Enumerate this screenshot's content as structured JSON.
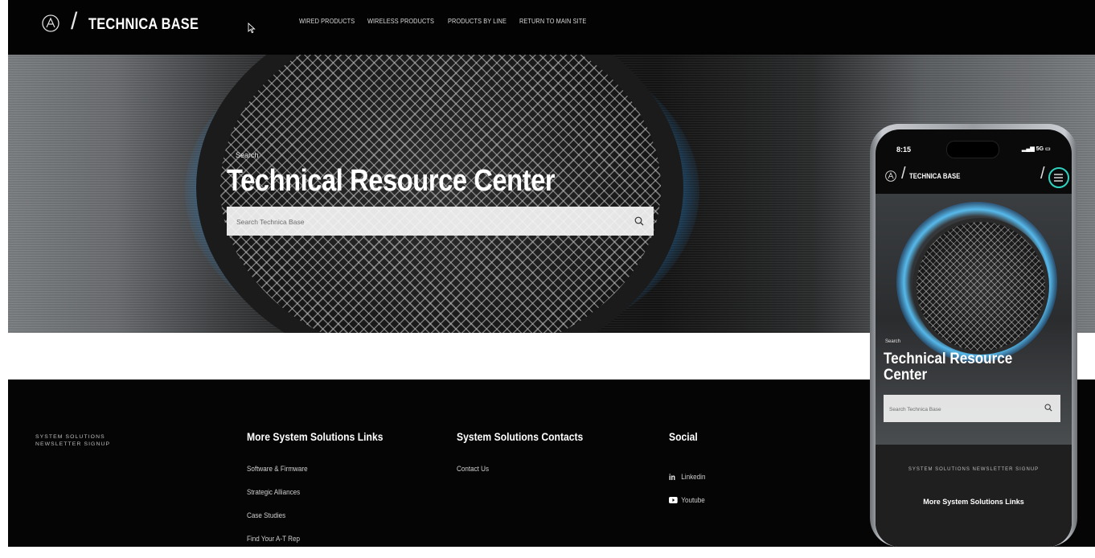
{
  "header": {
    "logo_text": "TECHNICA BASE",
    "nav": [
      "WIRED PRODUCTS",
      "WIRELESS PRODUCTS",
      "PRODUCTS BY LINE",
      "RETURN TO MAIN SITE"
    ]
  },
  "hero": {
    "eyebrow": "Search",
    "title": "Technical Resource Center",
    "search_placeholder": "Search Technica Base"
  },
  "footer": {
    "newsletter_line1": "SYSTEM SOLUTIONS",
    "newsletter_line2": "NEWSLETTER SIGNUP",
    "col1": {
      "heading": "More System Solutions Links",
      "links": [
        "Software & Firmware",
        "Strategic Alliances",
        "Case Studies",
        "Find Your A-T Rep"
      ]
    },
    "col2": {
      "heading": "System Solutions Contacts",
      "links": [
        "Contact Us"
      ]
    },
    "col3": {
      "heading": "Social",
      "links": [
        "Linkedin",
        "Youtube"
      ]
    }
  },
  "phone": {
    "time": "8:15",
    "status": "5G",
    "logo_text": "TECHNICA BASE",
    "eyebrow": "Search",
    "title": "Technical Resource Center",
    "search_placeholder": "Search Technica Base",
    "newsletter": "SYSTEM SOLUTIONS NEWSLETTER SIGNUP",
    "links_heading": "More System Solutions Links"
  },
  "colors": {
    "accent_teal": "#2fd3c0",
    "hero_glow": "#5ac8ff"
  }
}
